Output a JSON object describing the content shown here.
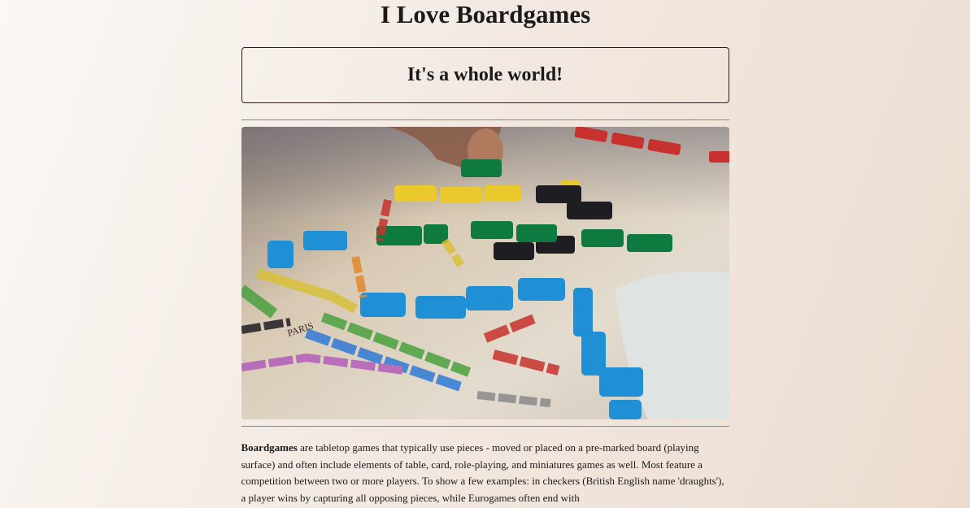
{
  "page": {
    "title": "I Love Boardgames"
  },
  "hero": {
    "heading": "It's a whole world!"
  },
  "photo": {
    "board_label": "PARIS"
  },
  "article": {
    "bold_term": "Boardgames",
    "text": " are tabletop games that typically use pieces - moved or placed on a pre-marked board (playing surface) and often include elements of table, card, role-playing, and miniatures games as well. Most feature a competition between two or more players. To show a few examples: in checkers (British English name 'draughts'), a player wins by capturing all opposing pieces, while Eurogames often end with"
  },
  "colors": {
    "text": "#1a1a1a",
    "border": "#2a1a1a",
    "rule": "#8a8a8a"
  }
}
